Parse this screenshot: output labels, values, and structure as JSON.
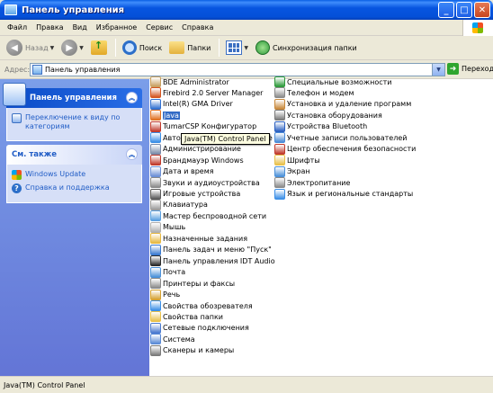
{
  "window": {
    "title": "Панель управления"
  },
  "menu": {
    "items": [
      "Файл",
      "Правка",
      "Вид",
      "Избранное",
      "Сервис",
      "Справка"
    ]
  },
  "toolbar": {
    "back_label": "Назад",
    "search_label": "Поиск",
    "folders_label": "Папки",
    "sync_label": "Синхронизация папки"
  },
  "address": {
    "label": "Адрес:",
    "value": "Панель управления",
    "go_label": "Переход"
  },
  "sidebar": {
    "panel1": {
      "title": "Панель управления",
      "link": "Переключение к виду по категориям"
    },
    "panel2": {
      "title": "См. также",
      "links": [
        "Windows Update",
        "Справка и поддержка"
      ]
    }
  },
  "items_col1": [
    {
      "label": "BDE Administrator",
      "color": "#c8a060"
    },
    {
      "label": "Firebird 2.0 Server Manager",
      "color": "#d4541e"
    },
    {
      "label": "Intel(R) GMA Driver",
      "color": "#2f6fd0"
    },
    {
      "label": "Java",
      "color": "#e07020"
    },
    {
      "label": "TumarCSP Конфигуратор",
      "color": "#c0392b"
    },
    {
      "label": "Автоматическое обновление",
      "color": "#3a8ee6"
    },
    {
      "label": "Администрирование",
      "color": "#7a8aa8"
    },
    {
      "label": "Брандмауэр Windows",
      "color": "#c0392b"
    },
    {
      "label": "Дата и время",
      "color": "#6b8fd6"
    },
    {
      "label": "Звуки и аудиоустройства",
      "color": "#8a8a8a"
    },
    {
      "label": "Игровые устройства",
      "color": "#5a5a5a"
    },
    {
      "label": "Клавиатура",
      "color": "#9a9a9a"
    },
    {
      "label": "Мастер беспроводной сети",
      "color": "#5aa0e0"
    },
    {
      "label": "Мышь",
      "color": "#b0b0b0"
    },
    {
      "label": "Назначенные задания",
      "color": "#e6b840"
    },
    {
      "label": "Панель задач и меню \"Пуск\"",
      "color": "#3a7ad0"
    },
    {
      "label": "Панель управления IDT Audio",
      "color": "#2a2a2a"
    },
    {
      "label": "Почта",
      "color": "#4a90d9"
    },
    {
      "label": "Принтеры и факсы",
      "color": "#8a8a8a"
    },
    {
      "label": "Речь",
      "color": "#d4a030"
    },
    {
      "label": "Свойства обозревателя",
      "color": "#3a8ee6"
    },
    {
      "label": "Свойства папки",
      "color": "#e8c04a"
    },
    {
      "label": "Сетевые подключения",
      "color": "#4a7ad0"
    },
    {
      "label": "Система",
      "color": "#5a8ad6"
    },
    {
      "label": "Сканеры и камеры",
      "color": "#7a7a7a"
    }
  ],
  "items_col2": [
    {
      "label": "Специальные возможности",
      "color": "#2e9a3b"
    },
    {
      "label": "Телефон и модем",
      "color": "#8a8a8a"
    },
    {
      "label": "Установка и удаление программ",
      "color": "#c8883a"
    },
    {
      "label": "Установка оборудования",
      "color": "#7a7a7a"
    },
    {
      "label": "Устройства Bluetooth",
      "color": "#2a5fc0"
    },
    {
      "label": "Учетные записи пользователей",
      "color": "#4a8ad6"
    },
    {
      "label": "Центр обеспечения безопасности",
      "color": "#c0392b"
    },
    {
      "label": "Шрифты",
      "color": "#e8c04a"
    },
    {
      "label": "Экран",
      "color": "#4a90d9"
    },
    {
      "label": "Электропитание",
      "color": "#8a8a8a"
    },
    {
      "label": "Язык и региональные стандарты",
      "color": "#3a8ee6"
    }
  ],
  "selected_item": "Java",
  "tooltip": "Java(TM) Control Panel",
  "status": "Java(TM) Control Panel"
}
